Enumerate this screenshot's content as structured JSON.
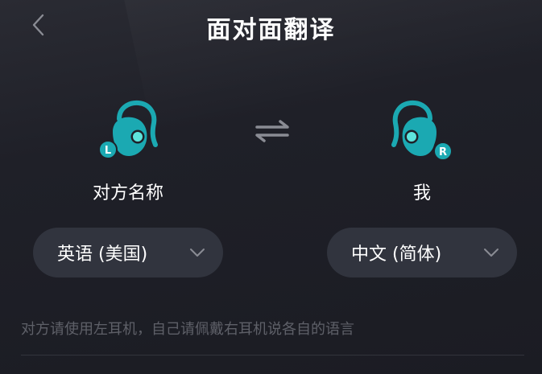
{
  "header": {
    "title": "面对面翻译",
    "back_icon": "chevron-left-icon"
  },
  "left_party": {
    "earbud_icon": "earbud-left-icon",
    "side_badge": "L",
    "name": "对方名称",
    "language": "英语 (美国)",
    "dropdown_icon": "chevron-down-icon"
  },
  "right_party": {
    "earbud_icon": "earbud-right-icon",
    "side_badge": "R",
    "name": "我",
    "language": "中文 (简体)",
    "dropdown_icon": "chevron-down-icon"
  },
  "swap_icon": "swap-arrows-icon",
  "hint_text": "对方请使用左耳机，自己请佩戴右耳机说各自的语言",
  "colors": {
    "accent": "#1ba9b2",
    "background": "#1c1d24",
    "select_background": "#31343e",
    "hint_text": "#5e6068"
  }
}
